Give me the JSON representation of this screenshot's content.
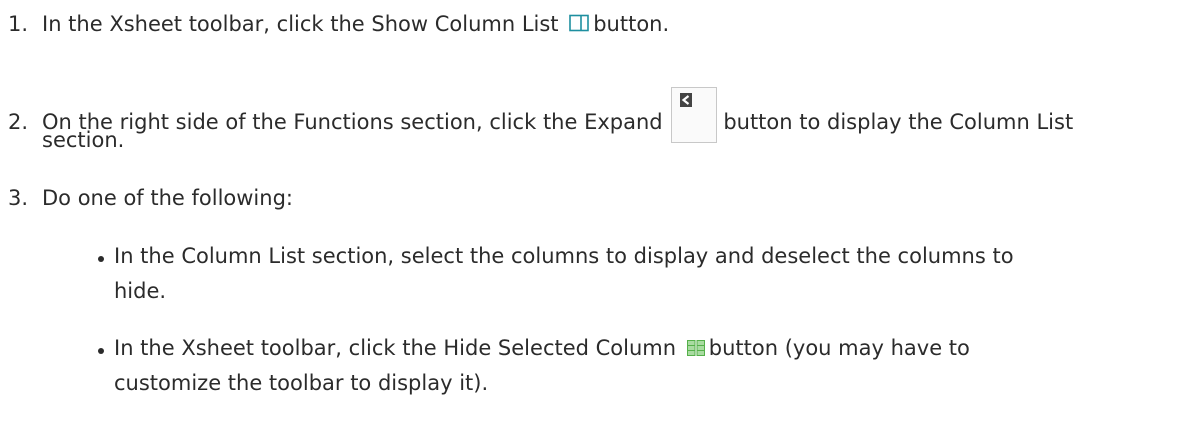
{
  "steps": [
    {
      "number": "1.",
      "text_before": "In the Xsheet toolbar, click the Show Column List",
      "icon": "show-column-list-icon",
      "text_after": "button."
    },
    {
      "number": "2.",
      "text_before": "On the right side of the Functions section, click the Expand",
      "icon": "expand-icon",
      "text_after": "button to display the Column List",
      "continuation": "section."
    },
    {
      "number": "3.",
      "text": "Do one of the following:"
    }
  ],
  "bullets": [
    {
      "line1": "In the Column List section, select the columns to display and deselect the columns to",
      "line2": "hide."
    },
    {
      "line1_before": "In the Xsheet toolbar, click the Hide Selected Column",
      "icon": "hide-selected-column-icon",
      "line1_after": "button (you may have to",
      "line2": "customize the toolbar to display it)."
    }
  ],
  "colors": {
    "text": "#2b2b2b",
    "icon_teal": "#1e8fa0",
    "icon_green": "#55b04a"
  }
}
